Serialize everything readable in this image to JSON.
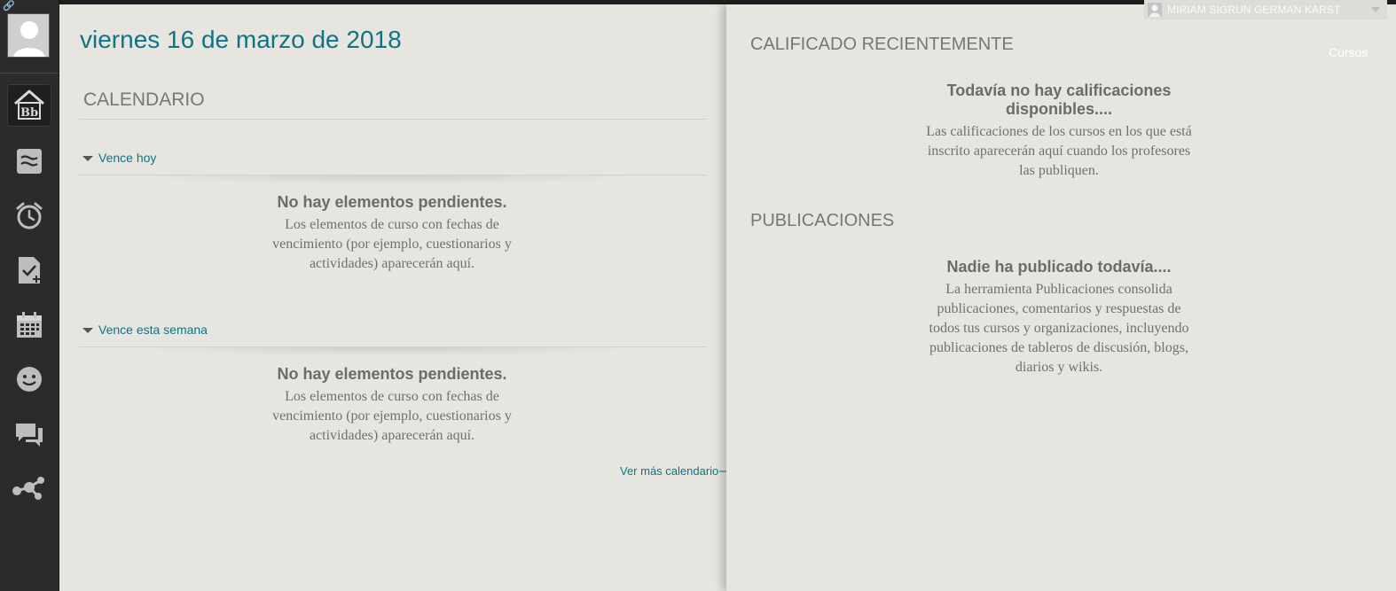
{
  "header": {
    "user_name": "MIRIAM SIGRUN GERMAN KARST",
    "courses_link": "Cursos"
  },
  "sidebar": {
    "items": [
      {
        "icon": "blackboard-home-icon",
        "active": true
      },
      {
        "icon": "activity-stream-icon"
      },
      {
        "icon": "due-dates-clock-icon"
      },
      {
        "icon": "grades-checklist-icon"
      },
      {
        "icon": "calendar-icon"
      },
      {
        "icon": "smiley-icon"
      },
      {
        "icon": "messages-icon"
      },
      {
        "icon": "network-icon"
      }
    ]
  },
  "main": {
    "date_title": "viernes 16 de marzo de 2018",
    "calendar": {
      "heading": "CALENDARIO",
      "due_today": {
        "label": "Vence hoy",
        "empty_title": "No hay elementos pendientes.",
        "empty_body": "Los elementos de curso con fechas de vencimiento (por ejemplo, cuestionarios y actividades) aparecerán aquí."
      },
      "due_this_week": {
        "label": "Vence esta semana",
        "empty_title": "No hay elementos pendientes.",
        "empty_body": "Los elementos de curso con fechas de vencimiento (por ejemplo, cuestionarios y actividades) aparecerán aquí."
      },
      "see_more": "Ver más calendario⟶"
    }
  },
  "right": {
    "graded": {
      "heading": "CALIFICADO RECIENTEMENTE",
      "empty_title": "Todavía no hay calificaciones disponibles....",
      "empty_body": "Las calificaciones de los cursos en los que está inscrito aparecerán aquí cuando los profesores las publiquen."
    },
    "posts": {
      "heading": "PUBLICACIONES",
      "empty_title": "Nadie ha publicado todavía....",
      "empty_body": "La herramienta Publicaciones consolida publicaciones, comentarios y respuestas de todos tus cursos y organizaciones, incluyendo publicaciones de tableros de discusión, blogs, diarios y wikis."
    }
  },
  "colors": {
    "accent": "#137383",
    "panel_bg": "#e6e5e0",
    "sidebar_bg": "#2b2b2b"
  }
}
